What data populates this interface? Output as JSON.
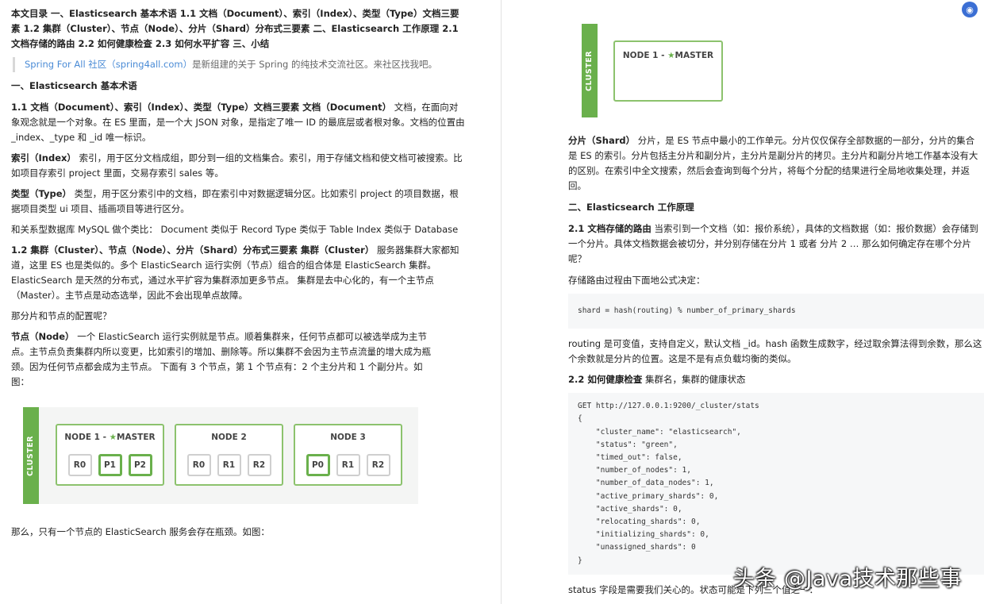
{
  "left": {
    "toc": "本文目录 一、Elasticsearch 基本术语 1.1 文档（Document）、索引（Index）、类型（Type）文档三要素 1.2 集群（Cluster）、节点（Node）、分片（Shard）分布式三要素 二、Elasticsearch 工作原理 2.1 文档存储的路由 2.2 如何健康检查 2.3 如何水平扩容 三、小结",
    "quote_link": "Spring For All 社区（spring4all.com）",
    "quote_text": "是新组建的关于 Spring 的纯技术交流社区。来社区找我吧。",
    "h1": "一、Elasticsearch 基本术语",
    "p1_bold": "1.1 文档（Document）、索引（Index）、类型（Type）文档三要素 文档（Document）",
    "p1_text": " 文档，在面向对象观念就是一个对象。在 ES 里面，是一个大 JSON 对象，是指定了唯一 ID 的最底层或者根对象。文档的位置由 _index、_type 和 _id 唯一标识。",
    "p2_bold": "索引（Index）",
    "p2_text": " 索引，用于区分文档成组，即分到一组的文档集合。索引，用于存储文档和使文档可被搜索。比如项目存索引 project 里面，交易存索引 sales 等。",
    "p3_bold": "类型（Type）",
    "p3_text": " 类型，用于区分索引中的文档，即在索引中对数据逻辑分区。比如索引 project 的项目数据，根据项目类型 ui 项目、插画项目等进行区分。",
    "p4_text": "和关系型数据库 MySQL 做个类比： Document 类似于 Record Type 类似于 Table Index 类似于 Database",
    "p5_bold": "1.2 集群（Cluster）、节点（Node）、分片（Shard）分布式三要素 集群（Cluster）",
    "p5_text": " 服务器集群大家都知道，这里 ES 也是类似的。多个 ElasticSearch 运行实例（节点）组合的组合体是 ElasticSearch 集群。ElasticSearch 是天然的分布式，通过水平扩容为集群添加更多节点。 集群是去中心化的，有一个主节点（Master）。主节点是动态选举，因此不会出现单点故障。",
    "p6_text": "那分片和节点的配置呢？",
    "p7_bold": "节点（Node）",
    "p7_text": " 一个 ElasticSearch 运行实例就是节点。顺着集群来，任何节点都可以被选举成为主节点。主节点负责集群内所以变更，比如索引的增加、删除等。所以集群不会因为主节点流量的增大成为瓶颈。因为任何节点都会成为主节点。 下面有 3 个节点，第 1 个节点有：2 个主分片和 1 个副分片。如图：",
    "p8_text": "那么，只有一个节点的 ElasticSearch 服务会存在瓶颈。如图："
  },
  "diagram_left": {
    "cluster_label": "CLUSTER",
    "nodes": [
      {
        "title": "NODE 1 - ",
        "master": "MASTER",
        "star": "★",
        "shards": [
          {
            "label": "R0",
            "primary": false
          },
          {
            "label": "P1",
            "primary": true
          },
          {
            "label": "P2",
            "primary": true
          }
        ]
      },
      {
        "title": "NODE 2",
        "master": "",
        "star": "",
        "shards": [
          {
            "label": "R0",
            "primary": false
          },
          {
            "label": "R1",
            "primary": false
          },
          {
            "label": "R2",
            "primary": false
          }
        ]
      },
      {
        "title": "NODE 3",
        "master": "",
        "star": "",
        "shards": [
          {
            "label": "P0",
            "primary": true
          },
          {
            "label": "R1",
            "primary": false
          },
          {
            "label": "R2",
            "primary": false
          }
        ]
      }
    ]
  },
  "diagram_right": {
    "cluster_label": "CLUSTER",
    "node_title": "NODE 1 - ",
    "star": "★",
    "master": "MASTER"
  },
  "right": {
    "p1_bold": "分片（Shard）",
    "p1_text": " 分片，是 ES 节点中最小的工作单元。分片仅仅保存全部数据的一部分，分片的集合是 ES 的索引。分片包括主分片和副分片，主分片是副分片的拷贝。主分片和副分片地工作基本没有大的区别。在索引中全文搜索，然后会查询到每个分片，将每个分配的结果进行全局地收集处理，并返回。",
    "h2": "二、Elasticsearch 工作原理",
    "p2_bold": "2.1 文档存储的路由",
    "p2_text": " 当索引到一个文档（如：报价系统），具体的文档数据（如：报价数据）会存储到一个分片。具体文档数据会被切分，并分别存储在分片 1 或者 分片 2 … 那么如何确定存在哪个分片呢？",
    "p3_text": "存储路由过程由下面地公式决定：",
    "code1": "shard = hash(routing) % number_of_primary_shards",
    "p4_text": "routing 是可变值，支持自定义，默认文档 _id。hash 函数生成数字，经过取余算法得到余数，那么这个余数就是分片的位置。这是不是有点负载均衡的类似。",
    "p5_bold": "2.2 如何健康检查",
    "p5_text": " 集群名，集群的健康状态",
    "code2": "GET http://127.0.0.1:9200/_cluster/stats\n{\n    \"cluster_name\": \"elasticsearch\",\n    \"status\": \"green\",\n    \"timed_out\": false,\n    \"number_of_nodes\": 1,\n    \"number_of_data_nodes\": 1,\n    \"active_primary_shards\": 0,\n    \"active_shards\": 0,\n    \"relocating_shards\": 0,\n    \"initializing_shards\": 0,\n    \"unassigned_shards\": 0\n}",
    "p6_text": "status 字段是需要我们关心的。状态可能是下列三个值之一："
  },
  "watermark": "头条 @Java技术那些事",
  "corner_icon": "translate-icon"
}
